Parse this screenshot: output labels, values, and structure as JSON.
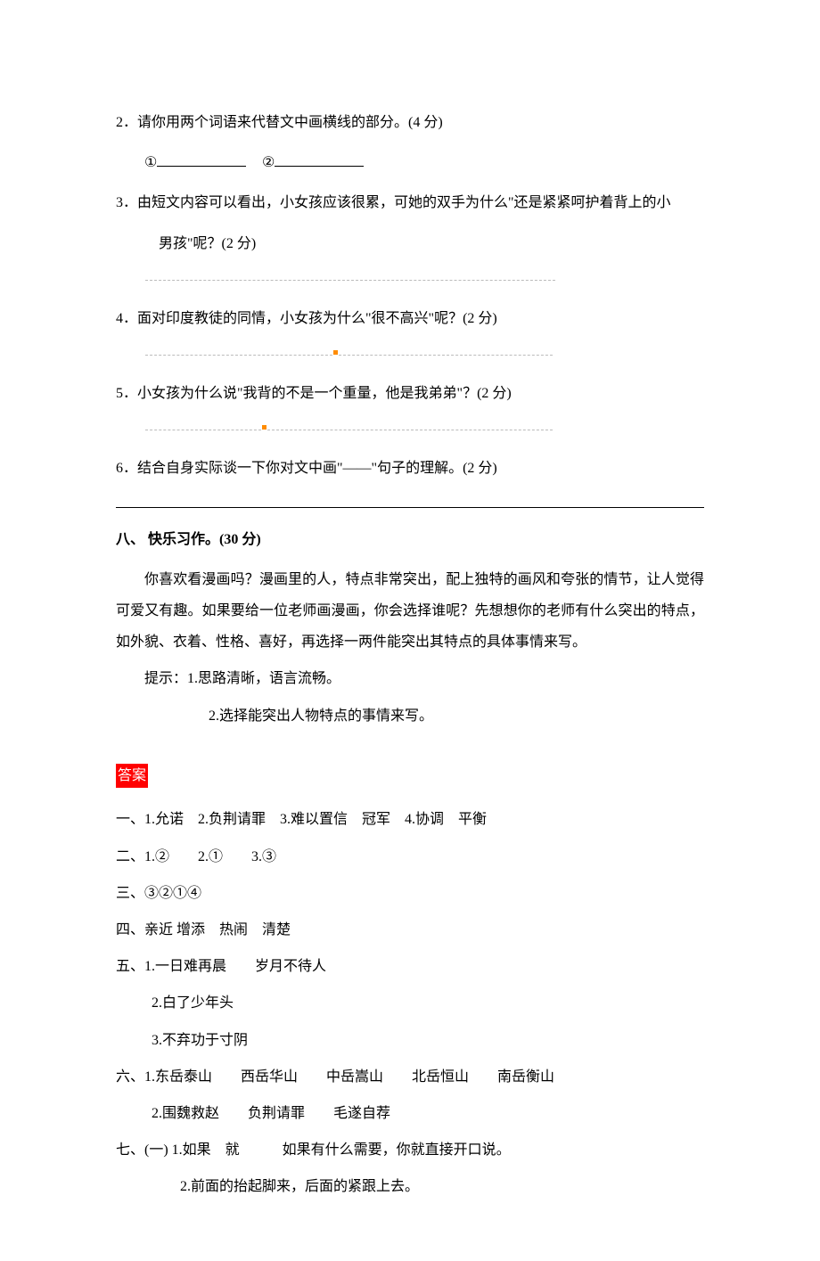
{
  "q2": {
    "text": "2．请你用两个词语来代替文中画横线的部分。(4 分)",
    "sub": "①____________　　②____________"
  },
  "q3": {
    "text": "3．由短文内容可以看出，小女孩应该很累，可她的双手为什么\"还是紧紧呵护着背上的小",
    "text2": "男孩\"呢？(2 分)"
  },
  "q4": {
    "text": "4．面对印度教徒的同情，小女孩为什么\"很不高兴\"呢？(2 分)"
  },
  "q5": {
    "text": "5．小女孩为什么说\"我背的不是一个重量，他是我弟弟\"？(2 分)"
  },
  "q6": {
    "text": "6．结合自身实际谈一下你对文中画\"——\"句子的理解。(2 分)"
  },
  "section8": {
    "title": "八、 快乐习作。(30 分)",
    "para": "你喜欢看漫画吗？漫画里的人，特点非常突出，配上独特的画风和夸张的情节，让人觉得可爱又有趣。如果要给一位老师画漫画，你会选择谁呢？先想想你的老师有什么突出的特点，如外貌、衣着、性格、喜好，再选择一两件能突出其特点的具体事情来写。",
    "hint_label": "提示：",
    "hint1": "1.思路清晰，语言流畅。",
    "hint2": "2.选择能突出人物特点的事情来写。"
  },
  "answers": {
    "label": "答案",
    "a1": "一、1.允诺　2.负荆请罪　3.难以置信　冠军　4.协调　平衡",
    "a2": "二、1.②　　2.①　　3.③",
    "a3": "三、③②①④",
    "a4": "四、亲近 增添　热闹　清楚",
    "a5_1": "五、1.一日难再晨　　岁月不待人",
    "a5_2": "2.白了少年头",
    "a5_3": "3.不弃功于寸阴",
    "a6_1": "六、1.东岳泰山　　西岳华山　　中岳嵩山　　北岳恒山　　南岳衡山",
    "a6_2": "2.围魏救赵　　负荆请罪　　毛遂自荐",
    "a7_1": "七、(一) 1.如果　就　　　如果有什么需要，你就直接开口说。",
    "a7_2": "2.前面的抬起脚来，后面的紧跟上去。"
  }
}
